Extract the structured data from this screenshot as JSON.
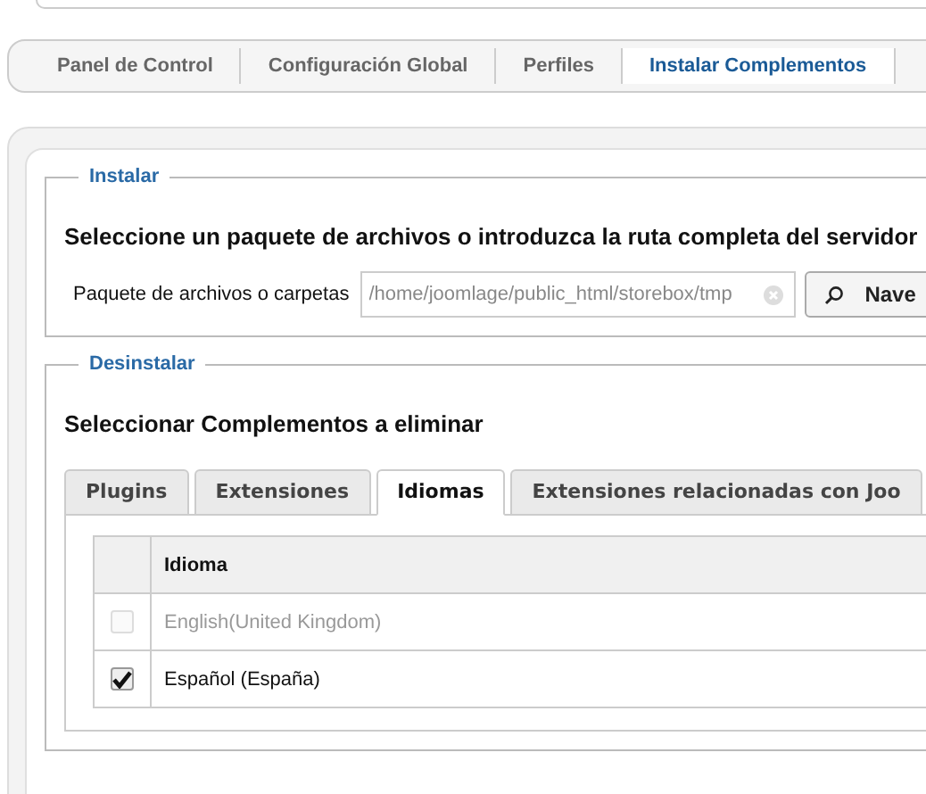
{
  "nav": [
    {
      "label": "Panel de Control",
      "selected": false
    },
    {
      "label": "Configuración Global",
      "selected": false
    },
    {
      "label": "Perfiles",
      "selected": false
    },
    {
      "label": "Instalar Complementos",
      "selected": true
    }
  ],
  "install": {
    "legend": "Instalar",
    "heading": "Seleccione un paquete de archivos o introduzca la ruta completa del servidor",
    "field_label": "Paquete de archivos o carpetas",
    "field_value": "/home/joomlage/public_html/storebox/tmp",
    "button": "Nave"
  },
  "uninstall": {
    "legend": "Desinstalar",
    "heading": "Seleccionar Complementos a eliminar",
    "tabs": [
      {
        "label": "Plugins",
        "selected": false
      },
      {
        "label": "Extensiones",
        "selected": false
      },
      {
        "label": "Idiomas",
        "selected": true
      },
      {
        "label": "Extensiones relacionadas con Joo",
        "selected": false
      }
    ],
    "table": {
      "columns": [
        "Idioma"
      ],
      "rows": [
        {
          "name": "English(United Kingdom)",
          "checked": false,
          "disabled": true
        },
        {
          "name": "Español (España)",
          "checked": true,
          "disabled": false
        }
      ]
    }
  }
}
